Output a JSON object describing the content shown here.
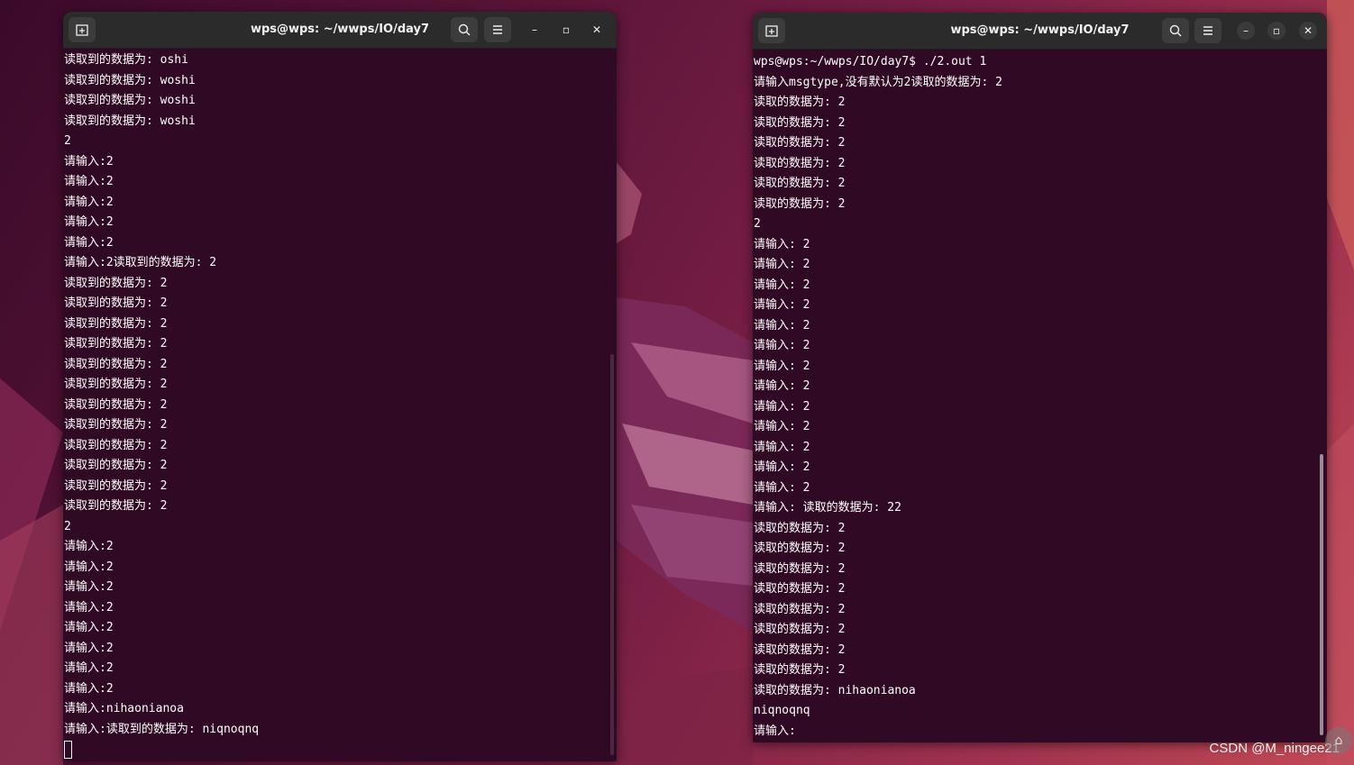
{
  "colors": {
    "terminal_bg": "#300a24",
    "titlebar_bg": "#2b2b2b",
    "text": "#ffffff"
  },
  "left_window": {
    "title": "wps@wps: ~/wwps/IO/day7",
    "lines": [
      "读取到的数据为: oshi",
      "读取到的数据为: woshi",
      "读取到的数据为: woshi",
      "读取到的数据为: woshi",
      "2",
      "请输入:2",
      "请输入:2",
      "请输入:2",
      "请输入:2",
      "请输入:2",
      "请输入:2读取到的数据为: 2",
      "读取到的数据为: 2",
      "读取到的数据为: 2",
      "读取到的数据为: 2",
      "读取到的数据为: 2",
      "读取到的数据为: 2",
      "读取到的数据为: 2",
      "读取到的数据为: 2",
      "读取到的数据为: 2",
      "读取到的数据为: 2",
      "读取到的数据为: 2",
      "读取到的数据为: 2",
      "读取到的数据为: 2",
      "2",
      "请输入:2",
      "请输入:2",
      "请输入:2",
      "请输入:2",
      "请输入:2",
      "请输入:2",
      "请输入:2",
      "请输入:2",
      "请输入:nihaonianoa",
      "请输入:读取到的数据为: niqnoqnq"
    ]
  },
  "right_window": {
    "title": "wps@wps: ~/wwps/IO/day7",
    "lines": [
      "wps@wps:~/wwps/IO/day7$ ./2.out 1",
      "请输入msgtype,没有默认为2读取的数据为: 2",
      "读取的数据为: 2",
      "读取的数据为: 2",
      "读取的数据为: 2",
      "读取的数据为: 2",
      "读取的数据为: 2",
      "读取的数据为: 2",
      "2",
      "请输入: 2",
      "请输入: 2",
      "请输入: 2",
      "请输入: 2",
      "请输入: 2",
      "请输入: 2",
      "请输入: 2",
      "请输入: 2",
      "请输入: 2",
      "请输入: 2",
      "请输入: 2",
      "请输入: 2",
      "请输入: 2",
      "请输入: 读取的数据为: 22",
      "读取的数据为: 2",
      "读取的数据为: 2",
      "读取的数据为: 2",
      "读取的数据为: 2",
      "读取的数据为: 2",
      "读取的数据为: 2",
      "读取的数据为: 2",
      "读取的数据为: 2",
      "读取的数据为: nihaonianoa",
      "niqnoqnq",
      "请输入:"
    ]
  },
  "icons": {
    "new_tab": "new-tab-icon",
    "search": "search-icon",
    "menu": "hamburger-menu-icon",
    "minimize": "minimize-icon",
    "maximize": "maximize-icon",
    "close": "close-icon"
  },
  "watermark": "CSDN @M_ningee21"
}
